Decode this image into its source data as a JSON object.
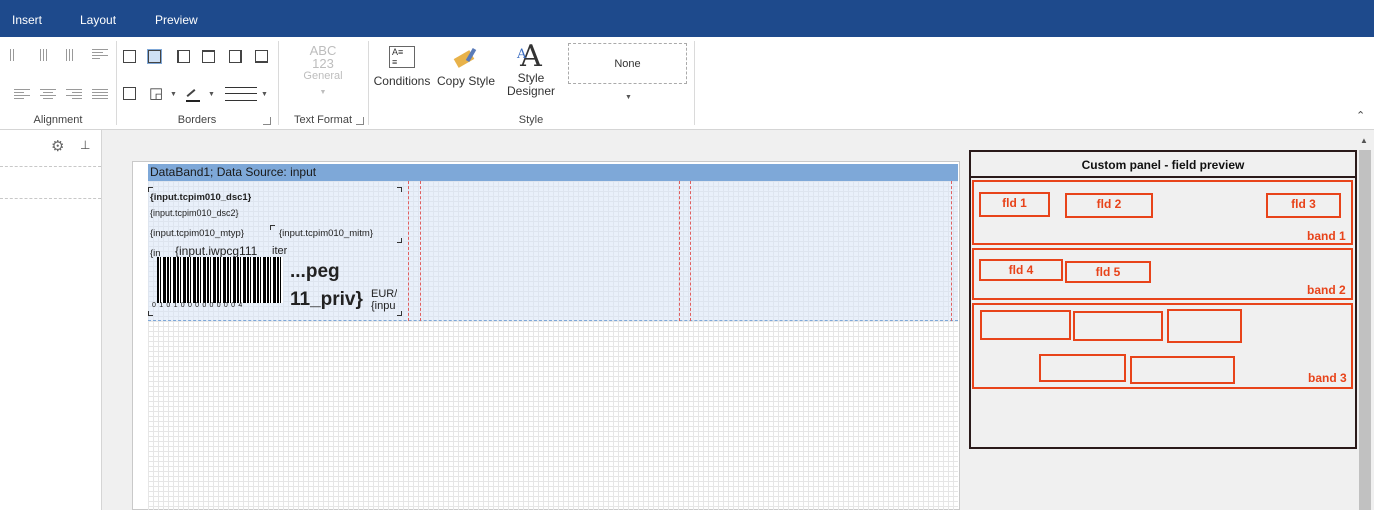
{
  "menu": {
    "tabs": [
      "Insert",
      "Layout",
      "Preview"
    ]
  },
  "ribbon": {
    "groups": {
      "alignment": "Alignment",
      "borders": "Borders",
      "text_format": "Text Format",
      "style": "Style"
    },
    "text_format": {
      "abc": "ABC",
      "num": "123",
      "general": "General"
    },
    "buttons": {
      "conditions": "Conditions",
      "copy_style": "Copy Style",
      "style_designer_1": "Style",
      "style_designer_2": "Designer"
    },
    "style_select": "None"
  },
  "designer": {
    "band_header": "DataBand1; Data Source: input",
    "fields": {
      "dsc1": "{input.tcpim010_dsc1}",
      "dsc2": "{input.tcpim010_dsc2}",
      "mtyp": "{input.tcpim010_mtyp}",
      "mitm": "{input.tcpim010_mitm}",
      "in_short": "{in",
      "iwpcg111": "{input.iwpcg111",
      "iter": "iter",
      "price_top": "...peg",
      "price": "11_priv}",
      "eur": "EUR/",
      "inpu": "{inpu"
    },
    "barcode_digits": "0101000000004"
  },
  "custom_panel": {
    "title": "Custom panel -  field preview",
    "bands": [
      {
        "label": "band 1",
        "fields": [
          "fld 1",
          "fld 2",
          "fld 3"
        ]
      },
      {
        "label": "band 2",
        "fields": [
          "fld 4",
          "fld 5"
        ]
      },
      {
        "label": "band 3",
        "fields": []
      }
    ]
  },
  "colors": {
    "title_bar": "#1e4a8c",
    "band_header": "#7ea8d8",
    "preview_accent": "#e8431a"
  }
}
